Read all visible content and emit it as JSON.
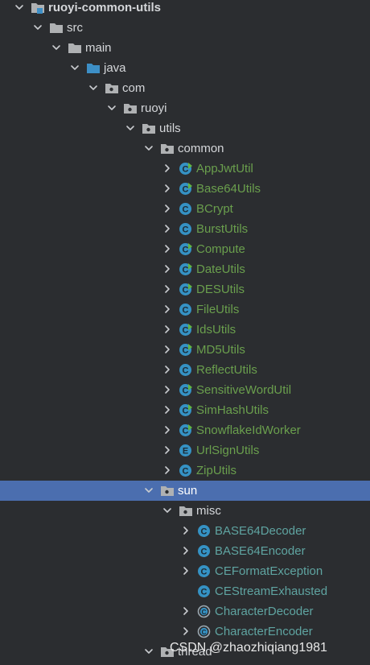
{
  "project": {
    "label": "ruoyi-common-utils"
  },
  "tree": [
    {
      "label": "ruoyi-common-utils",
      "icon": "module-folder-icon",
      "expanded": true,
      "bold": true
    },
    {
      "label": "src",
      "icon": "folder-icon",
      "expanded": true
    },
    {
      "label": "main",
      "icon": "folder-icon",
      "expanded": true
    },
    {
      "label": "java",
      "icon": "source-folder-icon",
      "expanded": true
    },
    {
      "label": "com",
      "icon": "package-icon",
      "expanded": true
    },
    {
      "label": "ruoyi",
      "icon": "package-icon",
      "expanded": true
    },
    {
      "label": "utils",
      "icon": "package-icon",
      "expanded": true
    },
    {
      "label": "common",
      "icon": "package-icon",
      "expanded": true
    },
    {
      "label": "AppJwtUtil",
      "icon": "class-modified-icon",
      "expanded": false
    },
    {
      "label": "Base64Utils",
      "icon": "class-modified-icon",
      "expanded": false
    },
    {
      "label": "BCrypt",
      "icon": "class-icon",
      "expanded": false
    },
    {
      "label": "BurstUtils",
      "icon": "class-icon",
      "expanded": false
    },
    {
      "label": "Compute",
      "icon": "class-modified-icon",
      "expanded": false
    },
    {
      "label": "DateUtils",
      "icon": "class-modified-icon",
      "expanded": false
    },
    {
      "label": "DESUtils",
      "icon": "class-modified-icon",
      "expanded": false
    },
    {
      "label": "FileUtils",
      "icon": "class-icon",
      "expanded": false
    },
    {
      "label": "IdsUtils",
      "icon": "class-modified-icon",
      "expanded": false
    },
    {
      "label": "MD5Utils",
      "icon": "class-modified-icon",
      "expanded": false
    },
    {
      "label": "ReflectUtils",
      "icon": "class-icon",
      "expanded": false
    },
    {
      "label": "SensitiveWordUtil",
      "icon": "class-modified-icon",
      "expanded": false
    },
    {
      "label": "SimHashUtils",
      "icon": "class-modified-icon",
      "expanded": false
    },
    {
      "label": "SnowflakeIdWorker",
      "icon": "class-modified-icon",
      "expanded": false
    },
    {
      "label": "UrlSignUtils",
      "icon": "enum-icon",
      "expanded": false
    },
    {
      "label": "ZipUtils",
      "icon": "class-icon",
      "expanded": false
    },
    {
      "label": "sun",
      "icon": "package-icon",
      "expanded": true,
      "selected": true
    },
    {
      "label": "misc",
      "icon": "package-icon",
      "expanded": true
    },
    {
      "label": "BASE64Decoder",
      "icon": "class-icon",
      "expanded": false
    },
    {
      "label": "BASE64Encoder",
      "icon": "class-icon",
      "expanded": false
    },
    {
      "label": "CEFormatException",
      "icon": "class-icon",
      "expanded": false
    },
    {
      "label": "CEStreamExhausted",
      "icon": "class-icon",
      "leaf": true
    },
    {
      "label": "CharacterDecoder",
      "icon": "abstract-class-icon",
      "expanded": false
    },
    {
      "label": "CharacterEncoder",
      "icon": "abstract-class-icon",
      "expanded": false
    },
    {
      "label": "thread",
      "icon": "package-icon",
      "expanded": true
    }
  ],
  "watermark": "CSDN @zhaozhiqiang1981",
  "colors": {
    "background": "#2b2d30",
    "selection": "#4b6eaf",
    "folder": "#afb1b3",
    "source_folder": "#3d8fc6",
    "class_icon": "#3592c4",
    "enum_icon": "#3592c4",
    "modified_badge": "#62b543",
    "green_text": "#6a9f4d",
    "teal_text": "#5fa4a1",
    "default_text": "#d5d7da"
  }
}
